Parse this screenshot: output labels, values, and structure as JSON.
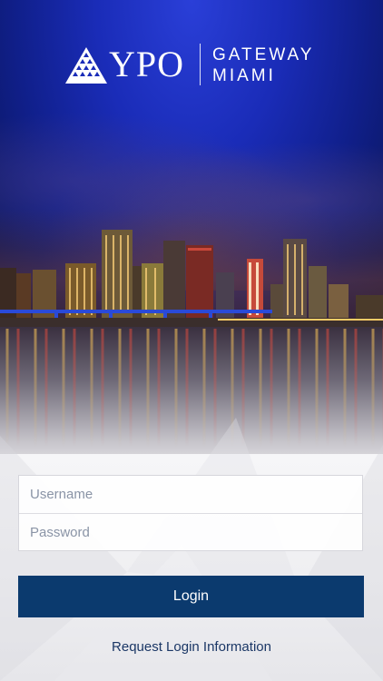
{
  "logo": {
    "brand": "YPO",
    "chapter_line_1": "GATEWAY",
    "chapter_line_2": "MIAMI"
  },
  "background": {
    "image": "miami-skyline-night"
  },
  "form": {
    "username_placeholder": "Username",
    "password_placeholder": "Password",
    "username_value": "",
    "password_value": ""
  },
  "actions": {
    "login_label": "Login",
    "request_login_label": "Request Login Information"
  },
  "colors": {
    "primary": "#0b3a6e",
    "link": "#1b3766",
    "sky": "#1a2cb8"
  }
}
